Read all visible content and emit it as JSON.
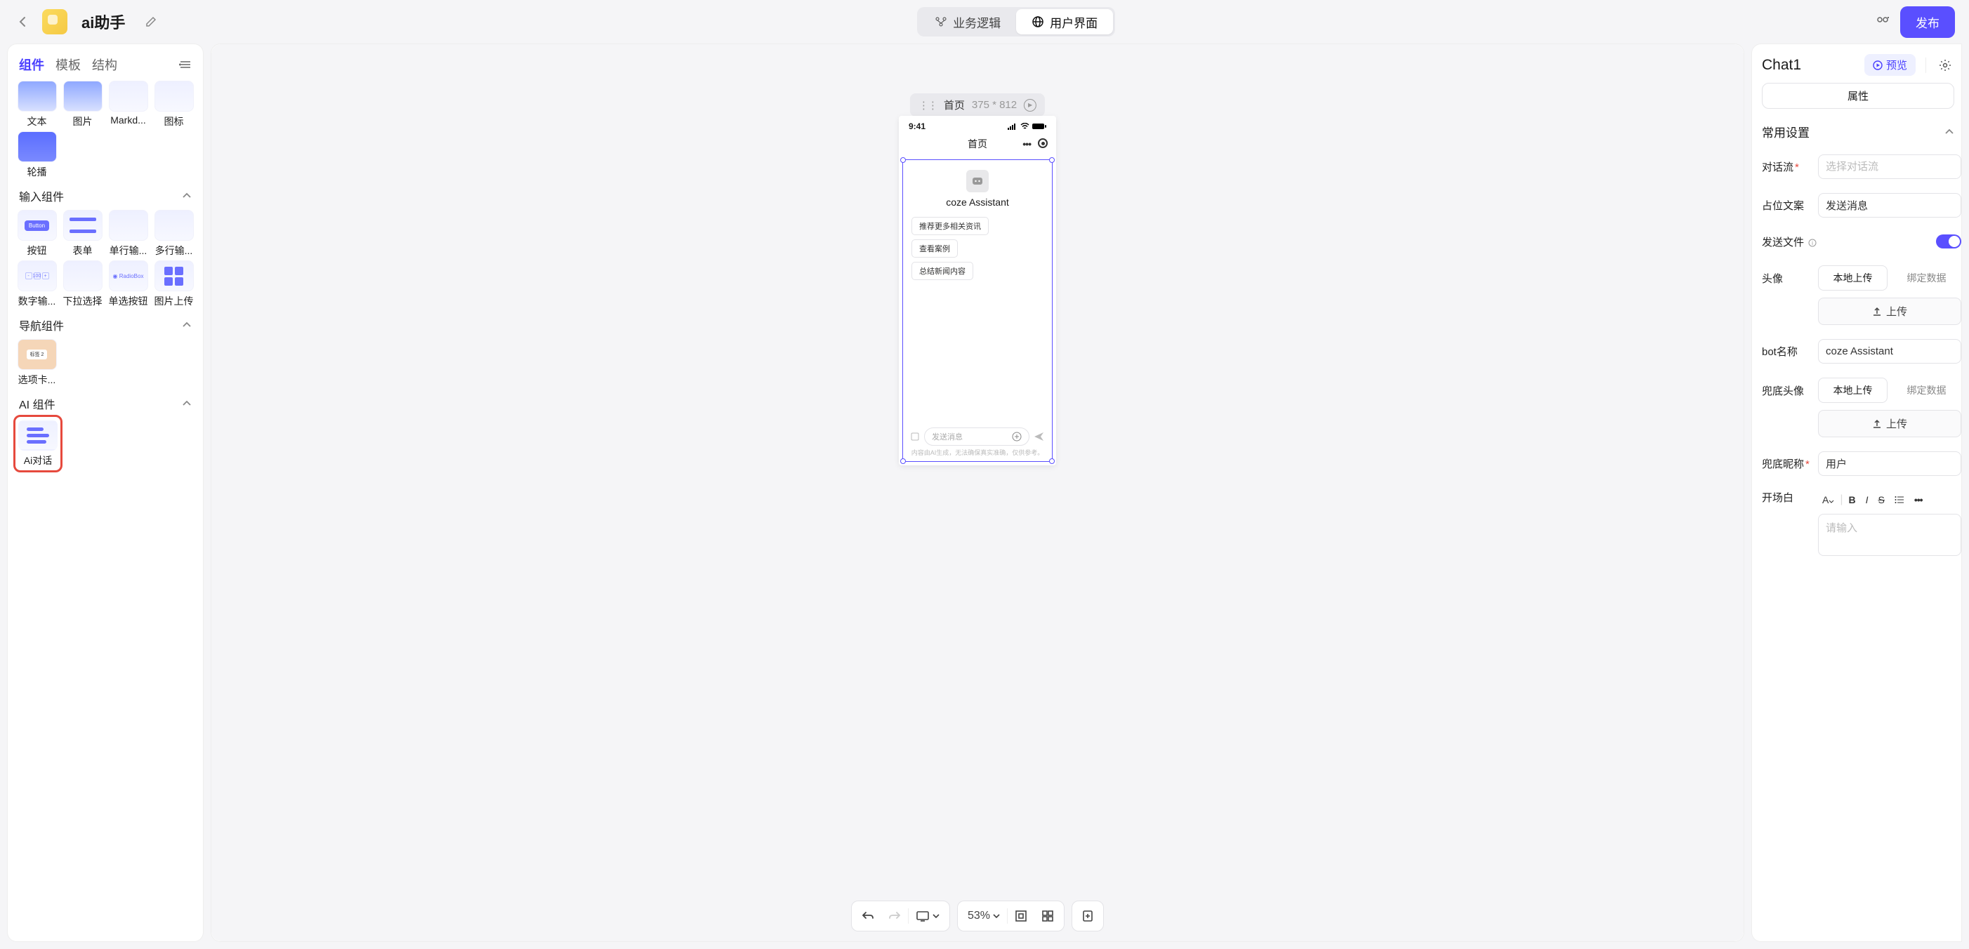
{
  "header": {
    "app_title": "ai助手",
    "tabs": {
      "logic": "业务逻辑",
      "ui": "用户界面"
    },
    "publish": "发布"
  },
  "left": {
    "tabs": {
      "components": "组件",
      "templates": "模板",
      "structure": "结构"
    },
    "basic_items": {
      "text": "文本",
      "image": "图片",
      "markdown": "Markd...",
      "icon": "图标",
      "carousel": "轮播"
    },
    "sections": {
      "input": "输入组件",
      "nav": "导航组件",
      "ai": "AI 组件"
    },
    "input_items": {
      "button": "按钮",
      "form": "表单",
      "single_input": "单行输...",
      "multi_input": "多行输...",
      "number": "数字输...",
      "dropdown": "下拉选择",
      "radio": "单选按钮",
      "image_upload": "图片上传"
    },
    "nav_items": {
      "tabs": "选项卡..."
    },
    "ai_items": {
      "chat": "Ai对话"
    },
    "thumb_text": {
      "button": "Button",
      "radio": "RadioBox",
      "tab": "标签 2"
    }
  },
  "canvas": {
    "page_name": "首页",
    "dimensions": "375 * 812",
    "phone": {
      "time": "9:41",
      "nav_title": "首页",
      "bot_name": "coze Assistant",
      "chips": [
        "推荐更多相关资讯",
        "查看案例",
        "总结新闻内容"
      ],
      "input_placeholder": "发送消息",
      "disclaimer": "内容由AI生成，无法确保真实准确，仅供参考。"
    },
    "zoom": "53%"
  },
  "right": {
    "title": "Chat1",
    "preview": "预览",
    "attr_tab": "属性",
    "section_title": "常用设置",
    "props": {
      "chatflow_label": "对话流",
      "chatflow_placeholder": "选择对话流",
      "placeholder_label": "占位文案",
      "placeholder_value": "发送消息",
      "file_label": "发送文件",
      "avatar_label": "头像",
      "upload_local": "本地上传",
      "bind_data": "绑定数据",
      "upload_btn": "上传",
      "bot_name_label": "bot名称",
      "bot_name_value": "coze Assistant",
      "fallback_avatar_label": "兜底头像",
      "fallback_nick_label": "兜底昵称",
      "fallback_nick_value": "用户",
      "opening_label": "开场白",
      "opening_placeholder": "请输入"
    },
    "rich_toolbar": {
      "format": "A",
      "bold": "B",
      "italic": "I",
      "strike": "S"
    }
  }
}
